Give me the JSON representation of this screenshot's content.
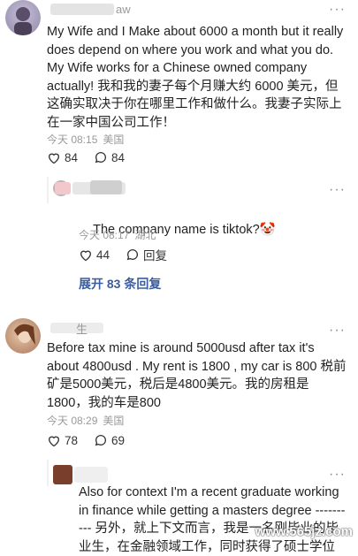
{
  "comment1": {
    "name": "aw",
    "more": "···",
    "text": "My Wife and I Make about 6000 a month but it really does depend on where you work and what you do. My Wife works for a Chinese owned company actually! 我和我的妻子每个月赚大约 6000 美元，但这确实取决于你在哪里工作和做什么。我妻子实际上在一家中国公司工作！",
    "time": "今天 08:15",
    "location": "美国",
    "likes": "84",
    "comments": "84"
  },
  "reply1": {
    "more": "···",
    "text": "The company name is tiktok?",
    "emoji": "🤡",
    "time": "今天 08:17",
    "location": "湖北",
    "likes": "44",
    "reply_label": "回复",
    "expand": "展开 83 条回复"
  },
  "comment2": {
    "name": "生",
    "more": "···",
    "text": "Before tax mine is around 5000usd after tax it's about 4800usd . My rent is 1800 , my car is 800 税前矿是5000美元，税后是4800美元。我的房租是1800，我的车是800",
    "time": "今天 08:29",
    "location": "美国",
    "likes": "78",
    "comments": "69"
  },
  "reply2": {
    "more": "···",
    "text": "Also for context I'm a recent graduate working in finance while getting a masters degree ---------- 另外，就上下文而言，我是一名刚毕业的毕业生，在金融领域工作，同时获得了硕士学位"
  },
  "watermark": "www.565jz.com",
  "colors": {
    "link": "#3b5c9e",
    "muted": "#9a9a9a",
    "text": "#222222"
  }
}
